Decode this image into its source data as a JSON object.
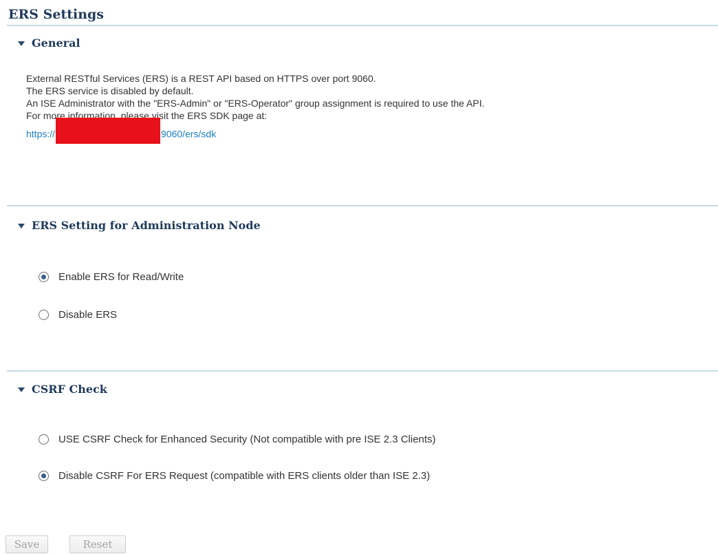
{
  "page": {
    "title": "ERS Settings"
  },
  "general": {
    "title": "General",
    "lines": [
      "External RESTful Services (ERS) is a REST API based on HTTPS over port 9060.",
      "The ERS service is disabled by default.",
      "An ISE Administrator with the \"ERS-Admin\" or \"ERS-Operator\" group assignment is required to use the API.",
      "For more information, please visit the ERS SDK page at:"
    ],
    "link_prefix": "https://",
    "link_suffix": "9060/ers/sdk"
  },
  "admin_node": {
    "title": "ERS Setting for Administration Node",
    "options": [
      {
        "label": "Enable ERS for Read/Write",
        "selected": true
      },
      {
        "label": "Disable ERS",
        "selected": false
      }
    ]
  },
  "csrf": {
    "title": "CSRF Check",
    "options": [
      {
        "label": "USE CSRF Check for Enhanced Security (Not compatible with pre ISE 2.3 Clients)",
        "selected": false
      },
      {
        "label": "Disable CSRF For ERS Request (compatible with ERS clients older than ISE 2.3)",
        "selected": true
      }
    ]
  },
  "buttons": {
    "save": "Save",
    "reset": "Reset"
  },
  "colors": {
    "heading": "#1f3a5c",
    "link": "#1b7fc2",
    "redaction": "#e8101a",
    "rule": "#c5dbe6"
  }
}
